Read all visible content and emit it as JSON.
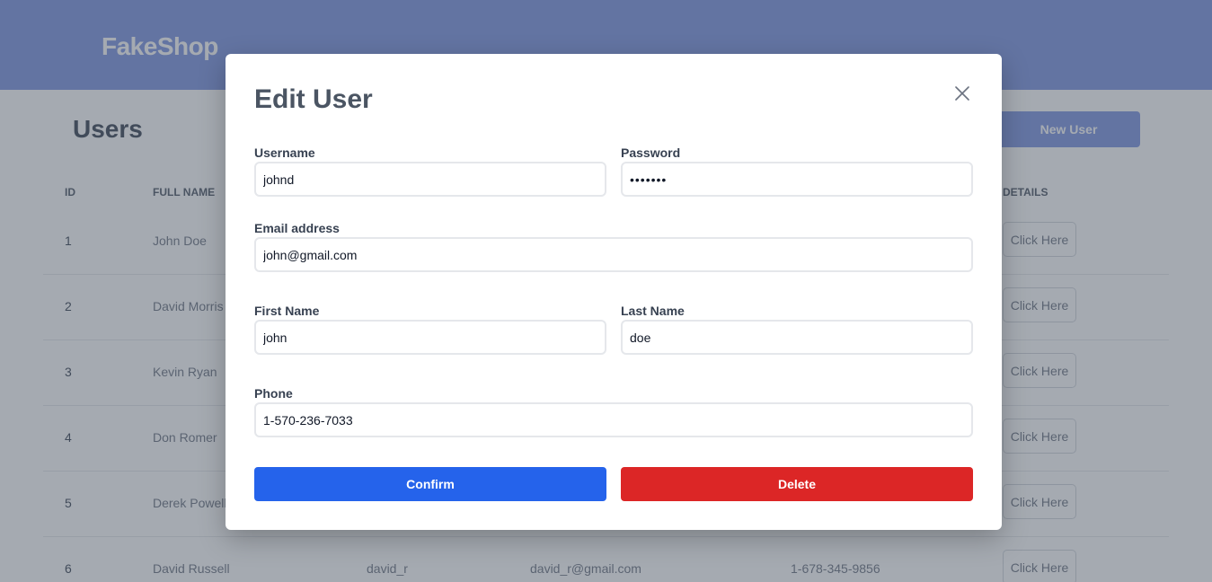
{
  "app": {
    "brand": "FakeShop"
  },
  "users_page": {
    "title": "Users",
    "new_user_label": "New User",
    "columns": [
      "ID",
      "FULL NAME",
      "",
      "",
      "",
      "DETAILS"
    ],
    "details_label": "Click Here",
    "rows": [
      {
        "id": "1",
        "full_name": "John Doe",
        "username": "",
        "email": "",
        "phone": ""
      },
      {
        "id": "2",
        "full_name": "David Morris",
        "username": "",
        "email": "",
        "phone": ""
      },
      {
        "id": "3",
        "full_name": "Kevin Ryan",
        "username": "",
        "email": "",
        "phone": ""
      },
      {
        "id": "4",
        "full_name": "Don Romer",
        "username": "",
        "email": "",
        "phone": ""
      },
      {
        "id": "5",
        "full_name": "Derek Powell",
        "username": "",
        "email": "",
        "phone": ""
      },
      {
        "id": "6",
        "full_name": "David Russell",
        "username": "david_r",
        "email": "david_r@gmail.com",
        "phone": "1-678-345-9856"
      }
    ]
  },
  "modal": {
    "title": "Edit User",
    "username": {
      "label": "Username",
      "value": "johnd"
    },
    "password": {
      "label": "Password",
      "value": "•••••••"
    },
    "email": {
      "label": "Email address",
      "value": "john@gmail.com"
    },
    "first_name": {
      "label": "First Name",
      "value": "john"
    },
    "last_name": {
      "label": "Last Name",
      "value": "doe"
    },
    "phone": {
      "label": "Phone",
      "value": "1-570-236-7033"
    },
    "confirm_label": "Confirm",
    "delete_label": "Delete"
  },
  "colors": {
    "header": "#7b93e0",
    "confirm": "#2563eb",
    "delete": "#dc2626"
  }
}
